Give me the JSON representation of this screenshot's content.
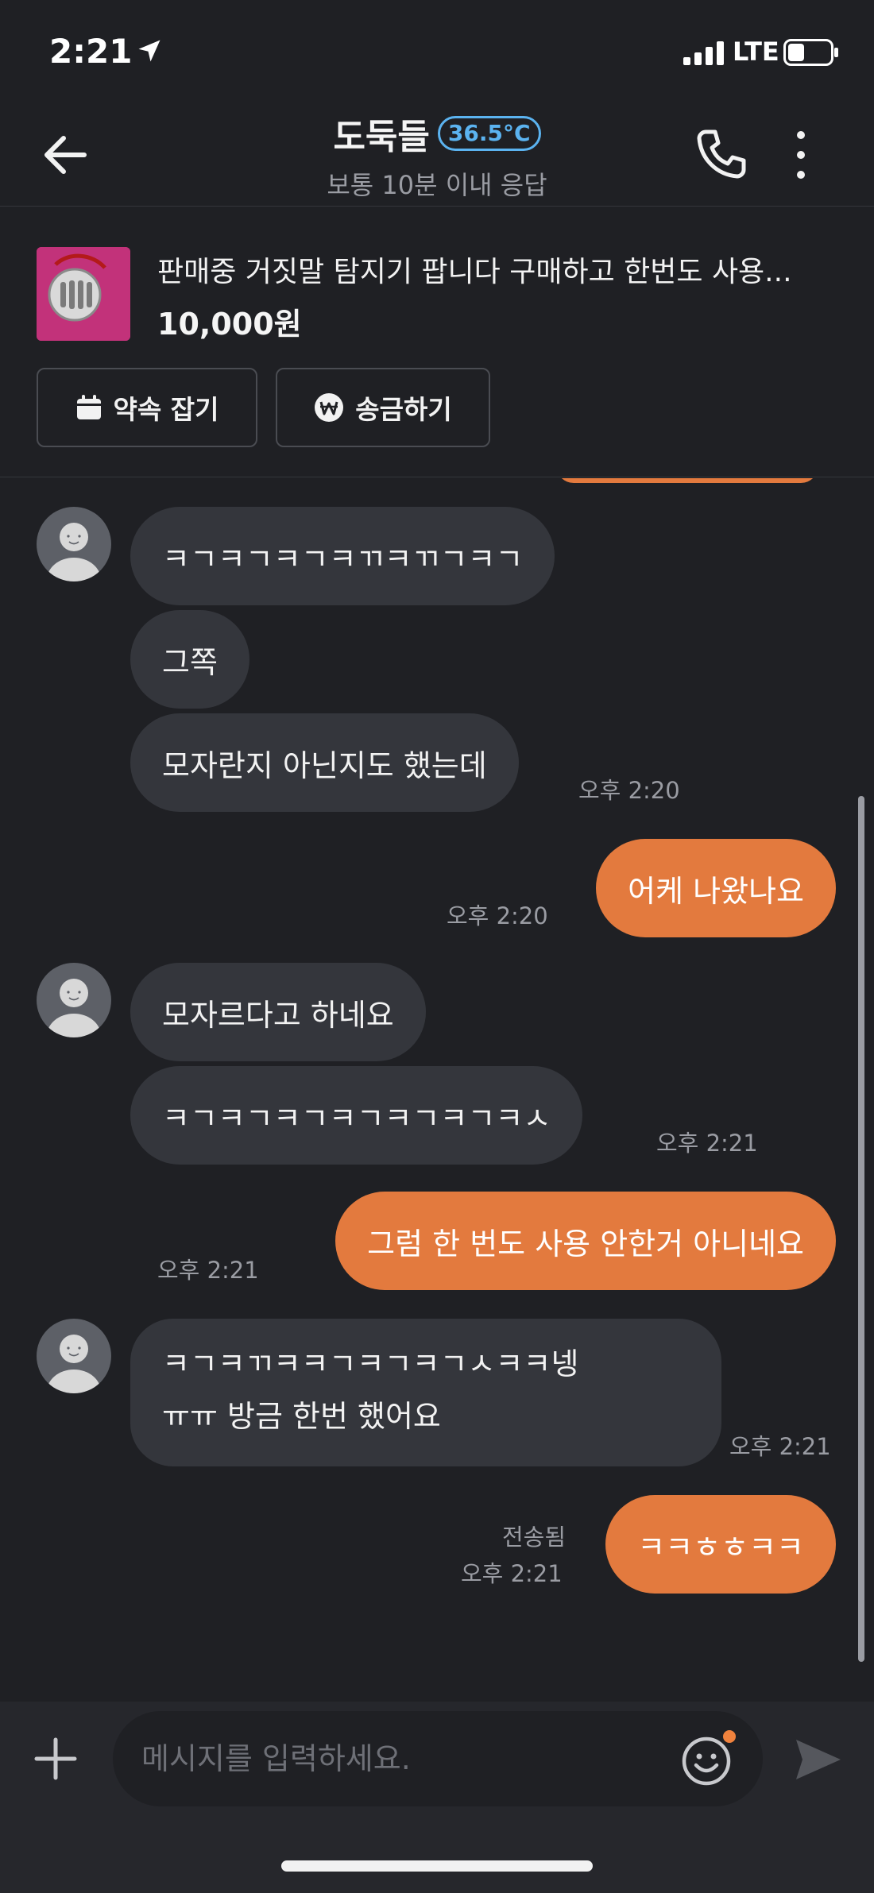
{
  "status_bar": {
    "time": "2:21",
    "network": "LTE",
    "icons": [
      "location-arrow-icon",
      "signal-bars-icon",
      "battery-icon"
    ]
  },
  "header": {
    "title": "도둑들",
    "temperature": "36.5°C",
    "subtitle": "보통 10분 이내 응답",
    "icons": [
      "back-arrow-icon",
      "phone-icon",
      "more-vertical-icon"
    ]
  },
  "product": {
    "title": "판매중 거짓말 탐지기 팝니다 구매하고 한번도 사용...",
    "price": "10,000원",
    "appoint_label": "약속 잡기",
    "remit_label": "송금하기"
  },
  "messages": [
    {
      "from": "them",
      "text": "ㅋㄱㅋㄱㅋㄱㅋㄲㅋㄲㄱㅋㄱ",
      "time": ""
    },
    {
      "from": "them",
      "text": "그쪽",
      "time": ""
    },
    {
      "from": "them",
      "text": "모자란지 아닌지도 했는데",
      "time": "오후 2:20"
    },
    {
      "from": "me",
      "text": "어케 나왔나요",
      "time": "오후 2:20"
    },
    {
      "from": "them",
      "text": "모자르다고 하네요",
      "time": ""
    },
    {
      "from": "them",
      "text": "ㅋㄱㅋㄱㅋㄱㅋㄱㅋㄱㅋㄱㅋㅅ",
      "time": "오후 2:21"
    },
    {
      "from": "me",
      "text": "그럼 한 번도 사용 안한거 아니네요",
      "time": "오후 2:21"
    },
    {
      "from": "them",
      "text_line1": "ㅋㄱㅋㄲㅋㅋㄱㅋㄱㅋㄱㅅㅋㅋ넹",
      "text_line2": "ㅠㅠ 방금 한번 했어요",
      "time": "오후 2:21"
    },
    {
      "from": "me",
      "text": "ㅋㅋㅎㅎㅋㅋ",
      "status": "전송됨",
      "time": "오후 2:21"
    }
  ],
  "input": {
    "placeholder": "메시지를 입력하세요."
  },
  "colors": {
    "background": "#1f2024",
    "incoming_bubble": "#34363c",
    "outgoing_bubble": "#e37a3e",
    "temperature_badge": "#5bb3f0",
    "muted_text": "#9a9ca3"
  }
}
